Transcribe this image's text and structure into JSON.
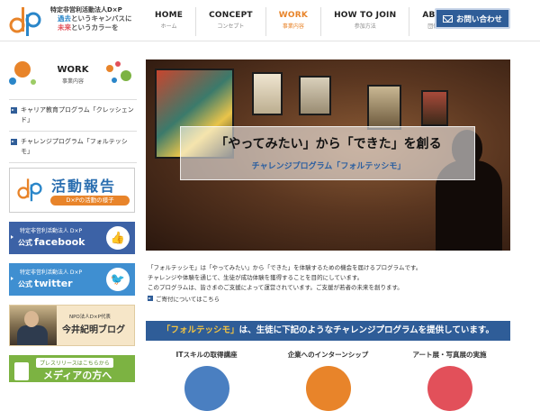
{
  "header": {
    "org_name": "特定非営利活動法人D×P",
    "slogan_line1_accent": "過去",
    "slogan_line1_rest": "というキャンバスに",
    "slogan_line2_accent": "未来",
    "slogan_line2_rest": "というカラーを",
    "nav": [
      {
        "label": "HOME",
        "sub": "ホーム"
      },
      {
        "label": "CONCEPT",
        "sub": "コンセプト"
      },
      {
        "label": "WORK",
        "sub": "事業内容"
      },
      {
        "label": "HOW TO JOIN",
        "sub": "参加方法"
      },
      {
        "label": "ABOUT",
        "sub": "団体概要"
      }
    ],
    "contact_label": "お問い合わせ",
    "colors": {
      "accent": "#e8842a",
      "brand_blue": "#2f5d98"
    }
  },
  "sidebar": {
    "title": "WORK",
    "subtitle": "事業内容",
    "links": [
      {
        "label": "キャリア教育プログラム「クレッシェンド」"
      },
      {
        "label": "チャレンジプログラム「フォルテッシモ」"
      }
    ],
    "report_banner": {
      "title": "活動報告",
      "sub": "D×Pの活動の様子"
    },
    "facebook_banner": {
      "sub": "特定非営利活動法人 D×P",
      "prefix": "公式",
      "title": "facebook"
    },
    "twitter_banner": {
      "sub": "特定非営利活動法人 D×P",
      "prefix": "公式",
      "title": "twitter"
    },
    "blog_banner": {
      "sub": "NPO法人D×P代表",
      "title": "今井紀明ブログ"
    },
    "press_banner": {
      "tag": "プレスリリースはこちらから",
      "title": "メディアの方へ"
    }
  },
  "main": {
    "hero_title": "「やってみたい」から「できた」を創る",
    "hero_sub": "チャレンジプログラム「フォルテッシモ」",
    "description": [
      "「フォルテッシモ」は「やってみたい」から「できた」を体験するための機会を届けるプログラムです。",
      "チャレンジや体験を通じて、生徒が成功体験を獲得することを目的にしています。",
      "このプログラムは、皆さまのご支援によって運営されています。ご支援が若者の未来を創ります。"
    ],
    "donate_link": "ご寄付についてはこちら",
    "banner_pre": "「フォルテッシモ」",
    "banner_rest": "は、生徒に下記のようなチャレンジプログラムを提供しています。",
    "categories": [
      {
        "label": "ITスキルの取得講座",
        "color": "#4a7fc1"
      },
      {
        "label": "企業へのインターンシップ",
        "color": "#e8842a"
      },
      {
        "label": "アート展・写真展の実施",
        "color": "#e2505a"
      }
    ]
  }
}
